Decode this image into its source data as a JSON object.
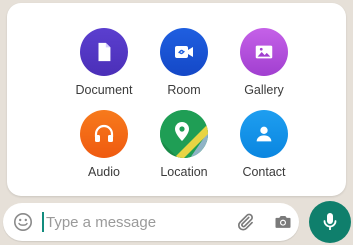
{
  "attach_menu": {
    "items": [
      {
        "label": "Document",
        "icon": "document-icon",
        "color": "#5b3fcf"
      },
      {
        "label": "Room",
        "icon": "video-link-icon",
        "color": "#1f5fe0"
      },
      {
        "label": "Gallery",
        "icon": "image-icon",
        "color": "#c561e8"
      },
      {
        "label": "Audio",
        "icon": "headphones-icon",
        "color": "#f77a1c"
      },
      {
        "label": "Location",
        "icon": "map-pin-icon",
        "color": "#1f9e55"
      },
      {
        "label": "Contact",
        "icon": "person-icon",
        "color": "#1e9ef0"
      }
    ]
  },
  "composer": {
    "placeholder": "Type a message",
    "value": "",
    "accent": "#128c7e",
    "mic_color": "#0f7f6c"
  }
}
